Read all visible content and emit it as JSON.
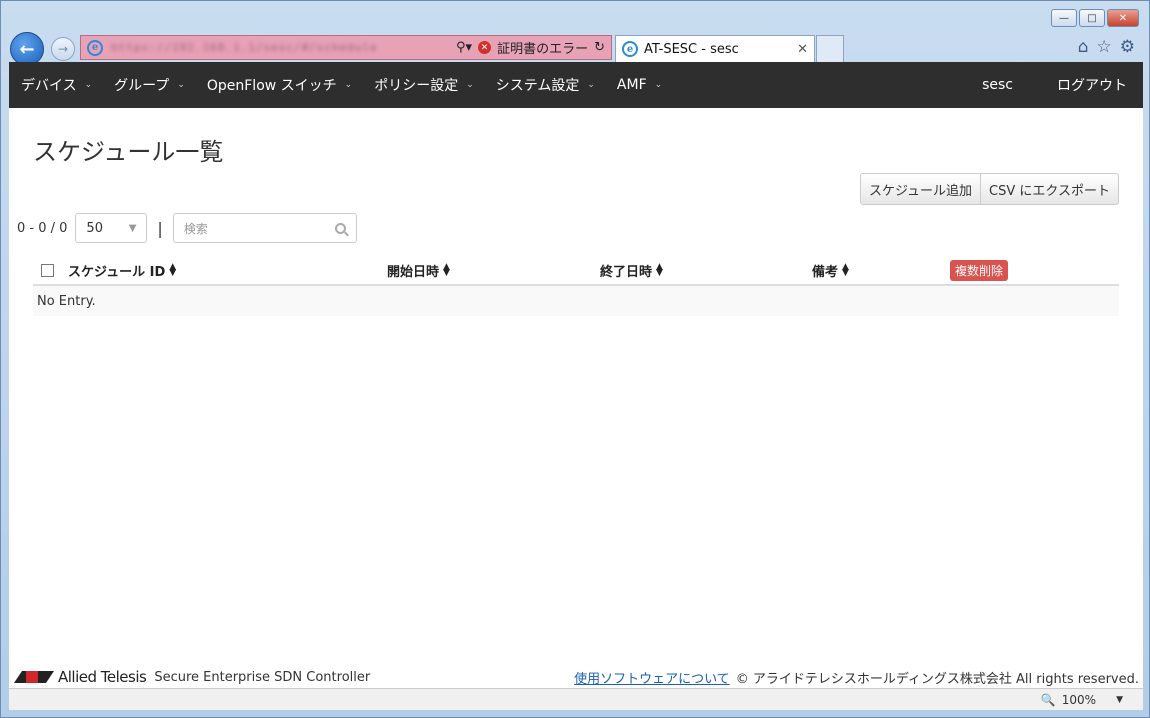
{
  "browser": {
    "tab_title": "AT-SESC - sesc",
    "cert_error": "証明書のエラー",
    "url_blurred": "https://192.168.1.1/sesc/#/schedule",
    "zoom": "100%",
    "icons": {
      "back": "back-arrow-icon",
      "forward": "forward-arrow-icon",
      "ie": "ie-logo-icon",
      "home": "home-icon",
      "favorites": "star-icon",
      "settings": "gear-icon"
    }
  },
  "nav": {
    "items": [
      {
        "label": "デバイス"
      },
      {
        "label": "グループ"
      },
      {
        "label": "OpenFlow スイッチ"
      },
      {
        "label": "ポリシー設定"
      },
      {
        "label": "システム設定"
      },
      {
        "label": "AMF"
      }
    ],
    "user": "sesc",
    "logout": "ログアウト"
  },
  "main": {
    "title": "スケジュール一覧",
    "add_button": "スケジュール追加",
    "export_button": "CSV にエクスポート",
    "count": "0 - 0 / 0",
    "page_size": "50",
    "separator": "|",
    "search_placeholder": "検索",
    "table": {
      "columns": [
        "スケジュール ID",
        "開始日時",
        "終了日時",
        "備考"
      ],
      "bulk_delete": "複数削除",
      "empty_text": "No Entry."
    }
  },
  "footer": {
    "brand": "Allied Telesis",
    "product": "Secure Enterprise SDN Controller",
    "link": "使用ソフトウェアについて",
    "copyright": "© アライドテレシスホールディングス株式会社 All rights reserved."
  },
  "colors": {
    "navbar_bg": "#2e2e2e",
    "danger": "#d9534f",
    "address_error": "#e7a2b6",
    "link": "#1a5fb4"
  }
}
